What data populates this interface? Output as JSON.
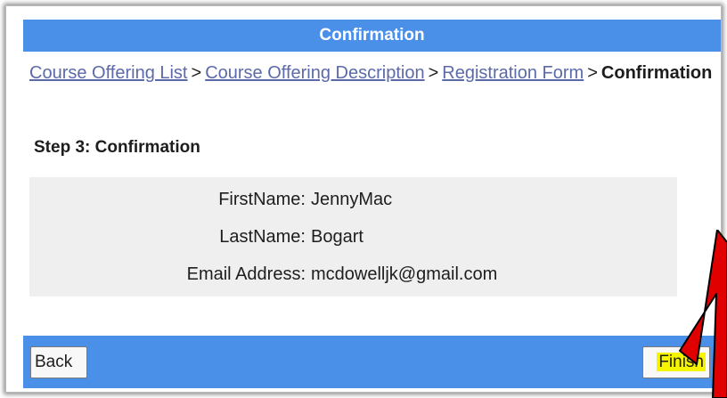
{
  "header": {
    "title": "Confirmation"
  },
  "breadcrumb": {
    "items": [
      "Course Offering List",
      "Course Offering Description",
      "Registration Form"
    ],
    "separator": ">",
    "current": "Confirmation"
  },
  "step": {
    "title": "Step 3: Confirmation"
  },
  "fields": [
    {
      "label": "FirstName:",
      "value": "JennyMac"
    },
    {
      "label": "LastName:",
      "value": "Bogart"
    },
    {
      "label": "Email Address:",
      "value": "mcdowelljk@gmail.com"
    }
  ],
  "buttons": {
    "back": "Back",
    "finish": "Finish"
  },
  "colors": {
    "accent": "#4a8fe8",
    "link": "#5c6aa9",
    "highlight": "#f5f500",
    "annotation_arrow": "#e00000"
  },
  "annotation": {
    "icon": "red-arrow-icon"
  }
}
